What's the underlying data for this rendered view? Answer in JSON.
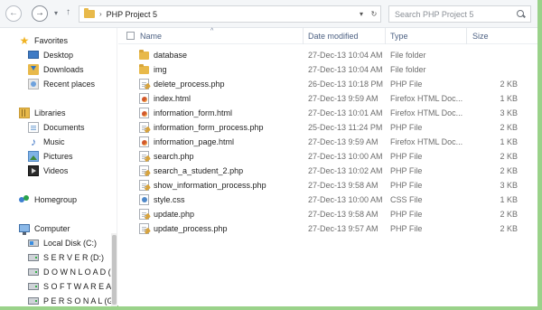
{
  "address_bar": {
    "crumbs": [
      "PHP Project 5"
    ],
    "separator": "›"
  },
  "search": {
    "placeholder": "Search PHP Project 5"
  },
  "nav_buttons": {
    "back": "←",
    "forward": "→",
    "recent": "▾",
    "up": "↑",
    "dropdown": "▾",
    "refresh": "↻"
  },
  "sidebar": {
    "favorites": {
      "label": "Favorites",
      "items": [
        "Desktop",
        "Downloads",
        "Recent places"
      ]
    },
    "libraries": {
      "label": "Libraries",
      "items": [
        "Documents",
        "Music",
        "Pictures",
        "Videos"
      ]
    },
    "homegroup": {
      "label": "Homegroup"
    },
    "computer": {
      "label": "Computer",
      "items": [
        "Local Disk (C:)",
        "S E R V E R (D:)",
        "D O W N L O A D (E:",
        "S O F T W A R E A (F",
        "P E R S O N A L (G:)"
      ]
    }
  },
  "columns": {
    "name": "Name",
    "date": "Date modified",
    "type": "Type",
    "size": "Size"
  },
  "files": [
    {
      "name": "database",
      "date": "27-Dec-13 10:04 AM",
      "type": "File folder",
      "size": "",
      "icon": "folder-icon"
    },
    {
      "name": "img",
      "date": "27-Dec-13 10:04 AM",
      "type": "File folder",
      "size": "",
      "icon": "folder-icon"
    },
    {
      "name": "delete_process.php",
      "date": "26-Dec-13 10:18 PM",
      "type": "PHP File",
      "size": "2 KB",
      "icon": "php-file-icon"
    },
    {
      "name": "index.html",
      "date": "27-Dec-13 9:59 AM",
      "type": "Firefox HTML Doc...",
      "size": "1 KB",
      "icon": "html-file-icon"
    },
    {
      "name": "information_form.html",
      "date": "27-Dec-13 10:01 AM",
      "type": "Firefox HTML Doc...",
      "size": "3 KB",
      "icon": "html-file-icon"
    },
    {
      "name": "information_form_process.php",
      "date": "25-Dec-13 11:24 PM",
      "type": "PHP File",
      "size": "2 KB",
      "icon": "php-file-icon"
    },
    {
      "name": "information_page.html",
      "date": "27-Dec-13 9:59 AM",
      "type": "Firefox HTML Doc...",
      "size": "1 KB",
      "icon": "html-file-icon"
    },
    {
      "name": "search.php",
      "date": "27-Dec-13 10:00 AM",
      "type": "PHP File",
      "size": "2 KB",
      "icon": "php-file-icon"
    },
    {
      "name": "search_a_student_2.php",
      "date": "27-Dec-13 10:02 AM",
      "type": "PHP File",
      "size": "2 KB",
      "icon": "php-file-icon"
    },
    {
      "name": "show_information_process.php",
      "date": "27-Dec-13 9:58 AM",
      "type": "PHP File",
      "size": "3 KB",
      "icon": "php-file-icon"
    },
    {
      "name": "style.css",
      "date": "27-Dec-13 10:00 AM",
      "type": "CSS File",
      "size": "1 KB",
      "icon": "css-file-icon"
    },
    {
      "name": "update.php",
      "date": "27-Dec-13 9:58 AM",
      "type": "PHP File",
      "size": "2 KB",
      "icon": "php-file-icon"
    },
    {
      "name": "update_process.php",
      "date": "27-Dec-13 9:57 AM",
      "type": "PHP File",
      "size": "2 KB",
      "icon": "php-file-icon"
    }
  ]
}
